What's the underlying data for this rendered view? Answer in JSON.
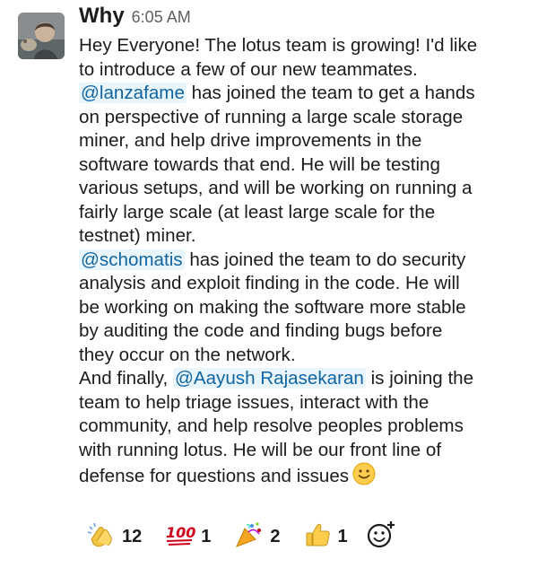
{
  "message": {
    "sender": "Why",
    "timestamp": "6:05 AM",
    "paragraphs": [
      [
        {
          "text": "Hey Everyone! The lotus team is growing! I'd like"
        }
      ],
      [
        {
          "text": "to introduce a few of our new teammates."
        }
      ],
      [
        {
          "text": "@lanzafame",
          "mention": true
        },
        {
          "text": " has joined the team to get a hands"
        }
      ],
      [
        {
          "text": "on perspective of running a large scale storage"
        }
      ],
      [
        {
          "text": "miner, and help drive improvements in the"
        }
      ],
      [
        {
          "text": "software towards that end. He will be testing"
        }
      ],
      [
        {
          "text": "various setups, and will be working on running a"
        }
      ],
      [
        {
          "text": "fairly large scale (at least large scale for the"
        }
      ],
      [
        {
          "text": "testnet) miner."
        }
      ],
      [
        {
          "text": "@schomatis",
          "mention": true
        },
        {
          "text": " has joined the team to do security"
        }
      ],
      [
        {
          "text": "analysis and exploit finding in the code. He will"
        }
      ],
      [
        {
          "text": "be working on making the software more stable"
        }
      ],
      [
        {
          "text": "by auditing the code and finding bugs before"
        }
      ],
      [
        {
          "text": "they occur on the network."
        }
      ],
      [
        {
          "text": "And finally, "
        },
        {
          "text": "@Aayush Rajasekaran",
          "mention": true
        },
        {
          "text": " is joining the"
        }
      ],
      [
        {
          "text": "team to help triage issues, interact with the"
        }
      ],
      [
        {
          "text": "community, and help resolve peoples problems"
        }
      ],
      [
        {
          "text": "with running lotus. He will be our front line of"
        }
      ],
      [
        {
          "text": "defense for questions and issues"
        },
        {
          "emoji": "slightly-smiling-face-icon"
        }
      ]
    ]
  },
  "reactions": [
    {
      "icon": "clapping-hands-icon",
      "count": "12"
    },
    {
      "icon": "hundred-points-icon",
      "count": "1"
    },
    {
      "icon": "party-popper-icon",
      "count": "2"
    },
    {
      "icon": "thumbs-up-icon",
      "count": "1"
    }
  ],
  "add_reaction": {
    "icon": "add-reaction-icon"
  }
}
